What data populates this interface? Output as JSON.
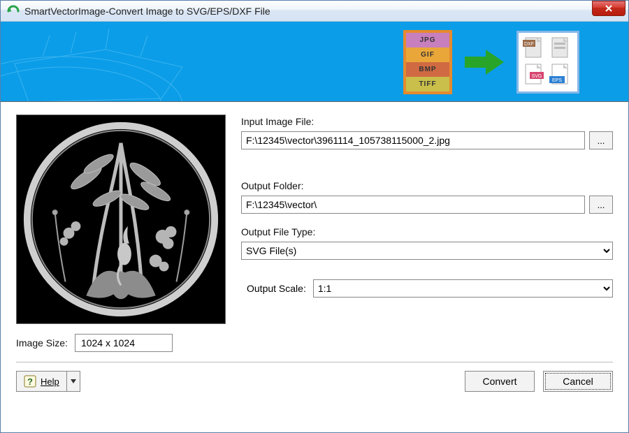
{
  "window": {
    "title": "SmartVectorImage-Convert Image to SVG/EPS/DXF File"
  },
  "banner": {
    "in_formats": [
      "JPG",
      "GIF",
      "BMP",
      "TIFF"
    ],
    "in_colors": [
      "#c77fbd",
      "#e9a73a",
      "#d06a42",
      "#c9bf4a"
    ],
    "out_formats": [
      "DXF",
      "SVG",
      "EPS"
    ]
  },
  "labels": {
    "input_file": "Input Image File:",
    "output_folder": "Output Folder:",
    "output_type": "Output File Type:",
    "output_scale": "Output Scale:",
    "image_size": "Image Size:",
    "browse": "...",
    "help": "Help",
    "convert": "Convert",
    "cancel": "Cancel"
  },
  "values": {
    "input_file": "F:\\12345\\vector\\3961114_105738115000_2.jpg",
    "output_folder": "F:\\12345\\vector\\",
    "output_type": "SVG File(s)",
    "output_scale": "1:1",
    "image_size": "1024 x 1024"
  }
}
